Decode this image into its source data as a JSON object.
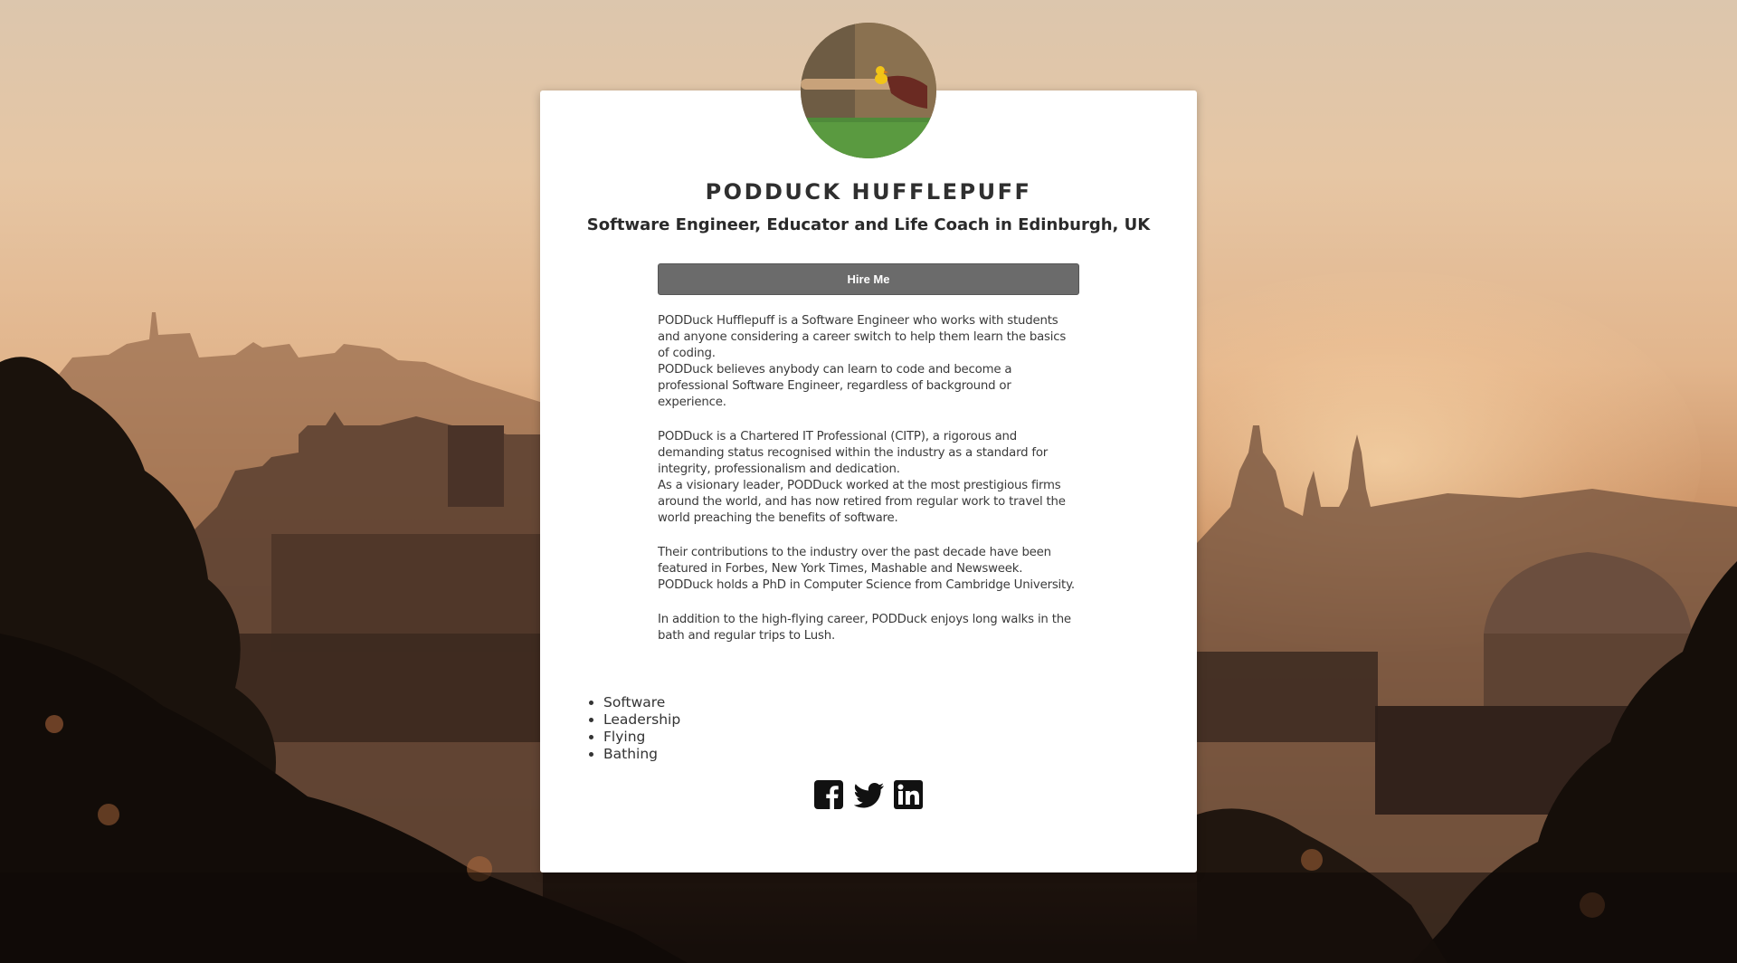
{
  "profile": {
    "name": "PODDUCK HUFFLEPUFF",
    "tagline": "Software Engineer, Educator and Life Coach in Edinburgh, UK",
    "hire_label": "Hire Me"
  },
  "bio": {
    "paragraphs": [
      {
        "a": "PODDuck Hufflepuff is a Software Engineer who works with students and anyone considering a career switch to help them learn the basics of coding.",
        "b": "PODDuck believes anybody can learn to code and become a professional Software Engineer, regardless of background or experience."
      },
      {
        "a": "PODDuck is a Chartered IT Professional (CITP), a rigorous and demanding status recognised within the industry as a standard for integrity, professionalism and dedication.",
        "b": "As a visionary leader, PODDuck worked at the most prestigious firms around the world, and has now retired from regular work to travel the world preaching the benefits of software."
      },
      {
        "a": "Their contributions to the industry over the past decade have been featured in Forbes, New York Times, Mashable and Newsweek.",
        "b": "PODDuck holds a PhD in Computer Science from Cambridge University."
      },
      {
        "a": "In addition to the high-flying career, PODDuck enjoys long walks in the bath and regular trips to Lush."
      }
    ]
  },
  "skills": [
    "Software",
    "Leadership",
    "Flying",
    "Bathing"
  ],
  "social": {
    "icons": [
      "facebook-icon",
      "twitter-icon",
      "linkedin-icon"
    ]
  },
  "colors": {
    "button": "#6b6b6b",
    "card": "#ffffff",
    "text": "#333333"
  }
}
